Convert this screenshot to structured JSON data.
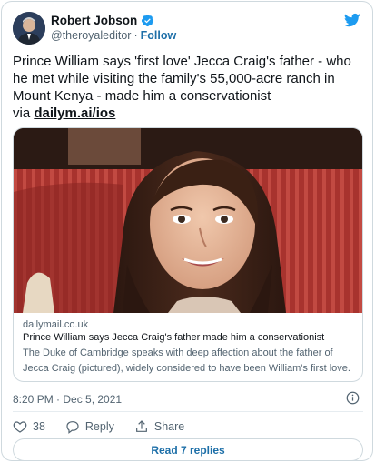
{
  "author": {
    "display_name": "Robert Jobson",
    "handle": "@theroyaleditor",
    "separator": "·",
    "follow_label": "Follow"
  },
  "tweet": {
    "text": "Prince William says 'first love' Jecca Craig's father - who he met while visiting the family's 55,000-acre ranch in Mount Kenya - made him a conservationist",
    "via_prefix": "via ",
    "link_text": "dailym.ai/ios"
  },
  "card": {
    "domain": "dailymail.co.uk",
    "title": "Prince William says Jecca Craig's father made him a conservationist",
    "description": "The Duke of Cambridge speaks with deep affection about the father of Jecca Craig (pictured), widely considered to have been William's first love."
  },
  "timestamp": "8:20 PM · Dec 5, 2021",
  "actions": {
    "like_count": "38",
    "reply_label": "Reply",
    "share_label": "Share"
  },
  "read_replies_label": "Read 7 replies",
  "colors": {
    "accent": "#1d9bf0",
    "link": "#1d6fa8",
    "muted": "#536471",
    "like_red": "#f91880"
  },
  "icons": [
    "verified-badge-icon",
    "twitter-bird-icon",
    "info-icon",
    "heart-icon",
    "reply-bubble-icon",
    "share-icon"
  ]
}
